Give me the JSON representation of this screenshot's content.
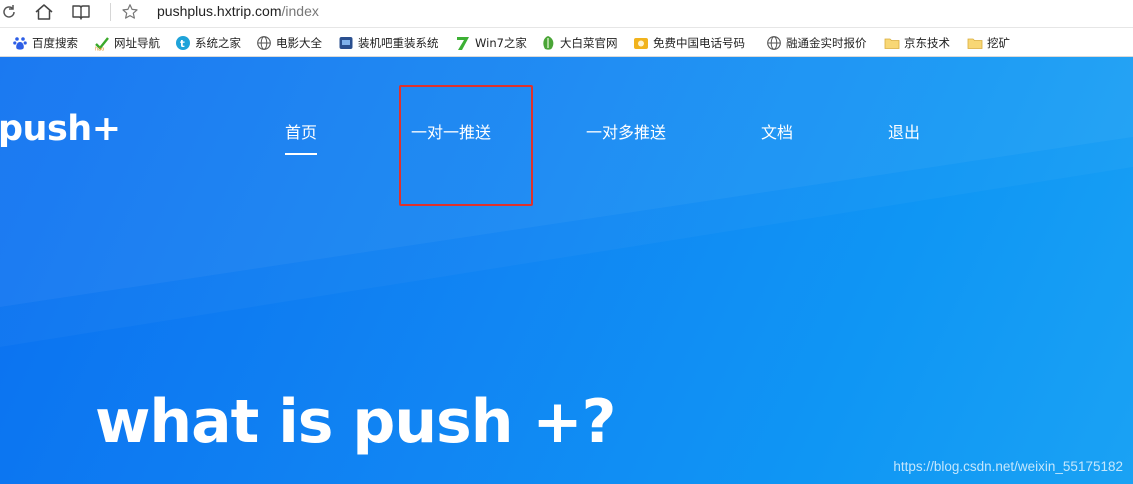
{
  "browser": {
    "url_host": "pushplus.hxtrip.com",
    "url_path": "/index",
    "bookmarks": [
      {
        "label": "百度搜索",
        "icon": "baidu-paw-icon"
      },
      {
        "label": "网址导航",
        "icon": "hao-icon"
      },
      {
        "label": "系统之家",
        "icon": "xitong-icon"
      },
      {
        "label": "电影大全",
        "icon": "globe-icon"
      },
      {
        "label": "装机吧重装系统",
        "icon": "zhuangji-icon"
      },
      {
        "label": "Win7之家",
        "icon": "win7-icon"
      },
      {
        "label": "大白菜官网",
        "icon": "dabaicai-icon"
      },
      {
        "label": "免费中国电话号码",
        "icon": "phone-icon"
      },
      {
        "label": "融通金实时报价",
        "icon": "globe-icon"
      },
      {
        "label": "京东技术",
        "icon": "folder-icon"
      },
      {
        "label": "挖矿",
        "icon": "folder-icon"
      }
    ]
  },
  "site": {
    "logo": "push+",
    "nav": [
      {
        "label": "首页",
        "active": true
      },
      {
        "label": "一对一推送"
      },
      {
        "label": "一对多推送"
      },
      {
        "label": "文档"
      },
      {
        "label": "退出"
      }
    ],
    "headline": "what is push +?",
    "watermark": "https://blog.csdn.net/weixin_55175182"
  },
  "colors": {
    "hero_start": "#0a6ff0",
    "hero_end": "#1aa2f4",
    "highlight_box": "#e0312b"
  }
}
